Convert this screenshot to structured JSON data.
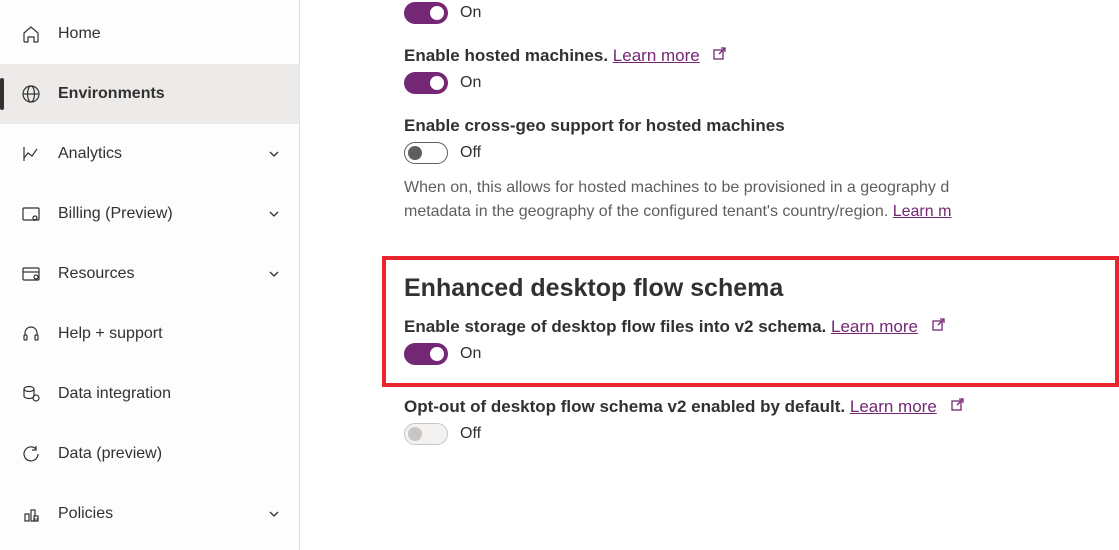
{
  "sidebar": {
    "items": [
      {
        "label": "Home"
      },
      {
        "label": "Environments"
      },
      {
        "label": "Analytics"
      },
      {
        "label": "Billing (Preview)"
      },
      {
        "label": "Resources"
      },
      {
        "label": "Help + support"
      },
      {
        "label": "Data integration"
      },
      {
        "label": "Data (preview)"
      },
      {
        "label": "Policies"
      }
    ]
  },
  "settings": {
    "s1": {
      "state": "On"
    },
    "hosted": {
      "title": "Enable hosted machines.",
      "learn": "Learn more",
      "state": "On"
    },
    "crossgeo": {
      "title": "Enable cross-geo support for hosted machines",
      "state": "Off",
      "desc1": "When on, this allows for hosted machines to be provisioned in a geography d",
      "desc2": "metadata in the geography of the configured tenant's country/region.",
      "learn": "Learn m"
    },
    "schema": {
      "heading": "Enhanced desktop flow schema",
      "title": "Enable storage of desktop flow files into v2 schema.",
      "learn": "Learn more",
      "state": "On"
    },
    "optout": {
      "title": "Opt-out of desktop flow schema v2 enabled by default.",
      "learn": "Learn more",
      "state": "Off"
    }
  }
}
